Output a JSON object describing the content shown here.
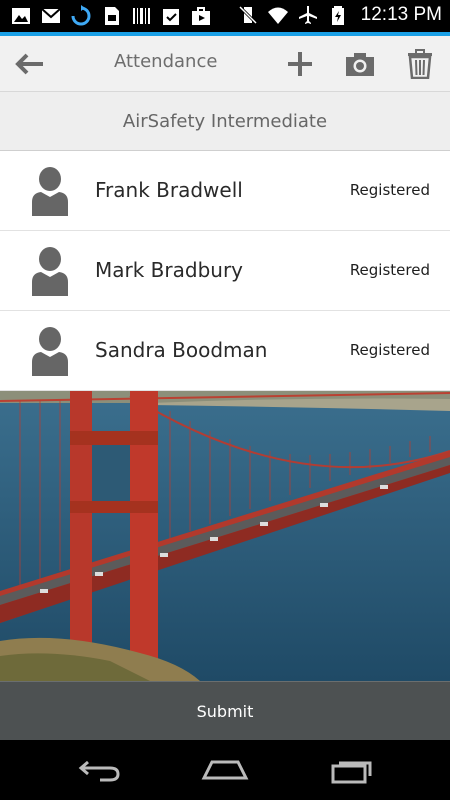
{
  "status_bar": {
    "time": "12:13 PM",
    "left_icons": [
      "image-icon",
      "gmail-icon",
      "sync-icon",
      "sd-card-icon",
      "barcode-icon",
      "clipboard-check-icon",
      "briefcase-play-icon"
    ],
    "right_icons": [
      "vibrate-off-icon",
      "wifi-icon",
      "airplane-icon",
      "battery-charging-icon"
    ]
  },
  "action_bar": {
    "title": "Attendance",
    "back_icon": "arrow-left-icon",
    "add_icon": "plus-icon",
    "camera_icon": "camera-icon",
    "delete_icon": "trash-icon"
  },
  "subheader": {
    "title": "AirSafety Intermediate"
  },
  "attendees": [
    {
      "name": "Frank Bradwell",
      "status": "Registered"
    },
    {
      "name": "Mark Bradbury",
      "status": "Registered"
    },
    {
      "name": "Sandra Boodman",
      "status": "Registered"
    }
  ],
  "submit": {
    "label": "Submit"
  },
  "colors": {
    "accent": "#1aa0e6",
    "action_bar_bg": "#f1f1f1",
    "submit_bg": "#4d5152",
    "bridge": "#c0392b"
  }
}
